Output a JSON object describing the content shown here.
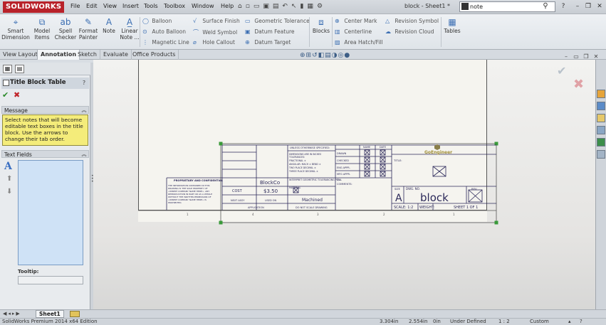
{
  "app": {
    "logo": "SOLIDWORKS",
    "document_title": "block - Sheet1 *"
  },
  "menu": [
    "File",
    "Edit",
    "View",
    "Insert",
    "Tools",
    "Toolbox",
    "Window",
    "Help"
  ],
  "search": {
    "value": "note"
  },
  "ribbon": {
    "big": [
      {
        "label": "Smart Dimension",
        "icon": "smart-dimension-icon"
      },
      {
        "label": "Model Items",
        "icon": "model-items-icon"
      },
      {
        "label": "Spell Checker",
        "icon": "spell-checker-icon"
      },
      {
        "label": "Format Painter",
        "icon": "format-painter-icon"
      },
      {
        "label": "Note",
        "icon": "note-icon"
      },
      {
        "label": "Linear Note ...",
        "icon": "linear-note-pattern-icon"
      }
    ],
    "col1": [
      "Balloon",
      "Auto Balloon",
      "Magnetic Line"
    ],
    "col2": [
      "Surface Finish",
      "Weld Symbol",
      "Hole Callout"
    ],
    "col3": [
      "Geometric Tolerance",
      "Datum Feature",
      "Datum Target"
    ],
    "blocks": "Blocks",
    "col4": [
      "Center Mark",
      "Centerline",
      "Area Hatch/Fill"
    ],
    "col5": [
      "Revision Symbol",
      "Revision Cloud"
    ],
    "tables": "Tables"
  },
  "tabs": [
    "View Layout",
    "Annotation",
    "Sketch",
    "Evaluate",
    "Office Products"
  ],
  "property_manager": {
    "title": "Title Block Table",
    "help": "?",
    "message_header": "Message",
    "message": "Select notes that will become editable text boxes in the title block. Use the arrows to change their tab order.",
    "text_fields_header": "Text Fields",
    "tooltip_label": "Tooltip:"
  },
  "title_block": {
    "dims_unless": "UNLESS OTHERWISE SPECIFIED:",
    "dims_lines": [
      "DIMENSIONS ARE IN INCHES",
      "TOLERANCES:",
      "FRACTIONAL ±",
      "ANGULAR: MACH ±  BEND ±",
      "TWO PLACE DECIMAL   ±",
      "THREE PLACE DECIMAL  ±"
    ],
    "interpret": "INTERPRET GEOMETRIC TOLERANCING PER:",
    "material": "MATERIAL",
    "finish_value": "Machined",
    "name_hdr": "NAME",
    "date_hdr": "DATE",
    "roles": [
      "DRAWN",
      "CHECKED",
      "ENG APPR.",
      "MFG APPR.",
      "Q.A.",
      "COMMENTS:"
    ],
    "next_assy": "NEXT ASSY",
    "used_on": "USED ON",
    "application": "APPLICATION",
    "do_not_scale": "DO NOT SCALE DRAWING",
    "proprietary_title": "PROPRIETARY AND CONFIDENTIAL",
    "proprietary_body": [
      "THE INFORMATION CONTAINED IN THIS",
      "DRAWING IS THE SOLE PROPERTY OF",
      "<INSERT COMPANY NAME HERE>. ANY",
      "REPRODUCTION IN PART OR AS A WHOLE",
      "WITHOUT THE WRITTEN PERMISSION OF",
      "<INSERT COMPANY NAME HERE> IS",
      "PROHIBITED."
    ],
    "company": "BlockCo",
    "cost_label": "COST",
    "cost_value": "$3.50",
    "logo_text": "GoEngineer",
    "title_label": "TITLE:",
    "size_label": "SIZE",
    "size_value": "A",
    "dwg_label": "DWG. NO.",
    "dwg_value": "block",
    "rev_label": "REV",
    "scale": "SCALE: 1:2",
    "weight": "WEIGHT:",
    "sheet": "SHEET 1 OF 1",
    "zone_numbers": [
      "1",
      "4",
      "3",
      "2",
      "1"
    ]
  },
  "sheet_tab": "Sheet1",
  "status": {
    "edition": "SolidWorks Premium 2014 x64 Edition",
    "x": "3.304in",
    "y": "2.554in",
    "z": "0in",
    "state": "Under Defined",
    "scale": "1 : 2",
    "units": "Custom"
  }
}
